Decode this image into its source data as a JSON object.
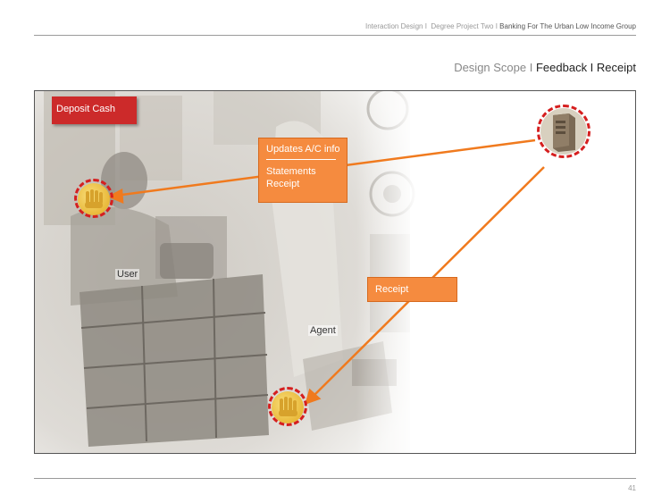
{
  "header": {
    "breadcrumb_part1": "Interaction Design I",
    "breadcrumb_part2": "Degree Project Two I",
    "breadcrumb_part3": "Banking For The Urban Low Income Group"
  },
  "title": {
    "prefix": "Design Scope I",
    "main": "Feedback I Receipt"
  },
  "scene": {
    "deposit_tag": "Deposit Cash",
    "user_label": "User",
    "agent_label": "Agent",
    "update_box": {
      "line1": "Updates A/C info",
      "line2": "Statements",
      "line3": "Receipt"
    },
    "receipt_box": "Receipt"
  },
  "colors": {
    "accent_orange": "#f58b3f",
    "tag_red": "#cc2a2a",
    "dash_red": "#d51f1f",
    "coin_yellow": "#f1c84b"
  },
  "icons": {
    "user_hand": "hand-icon",
    "agent_hand": "hand-icon",
    "server": "server-icon"
  },
  "footer": {
    "page_number": "41"
  }
}
